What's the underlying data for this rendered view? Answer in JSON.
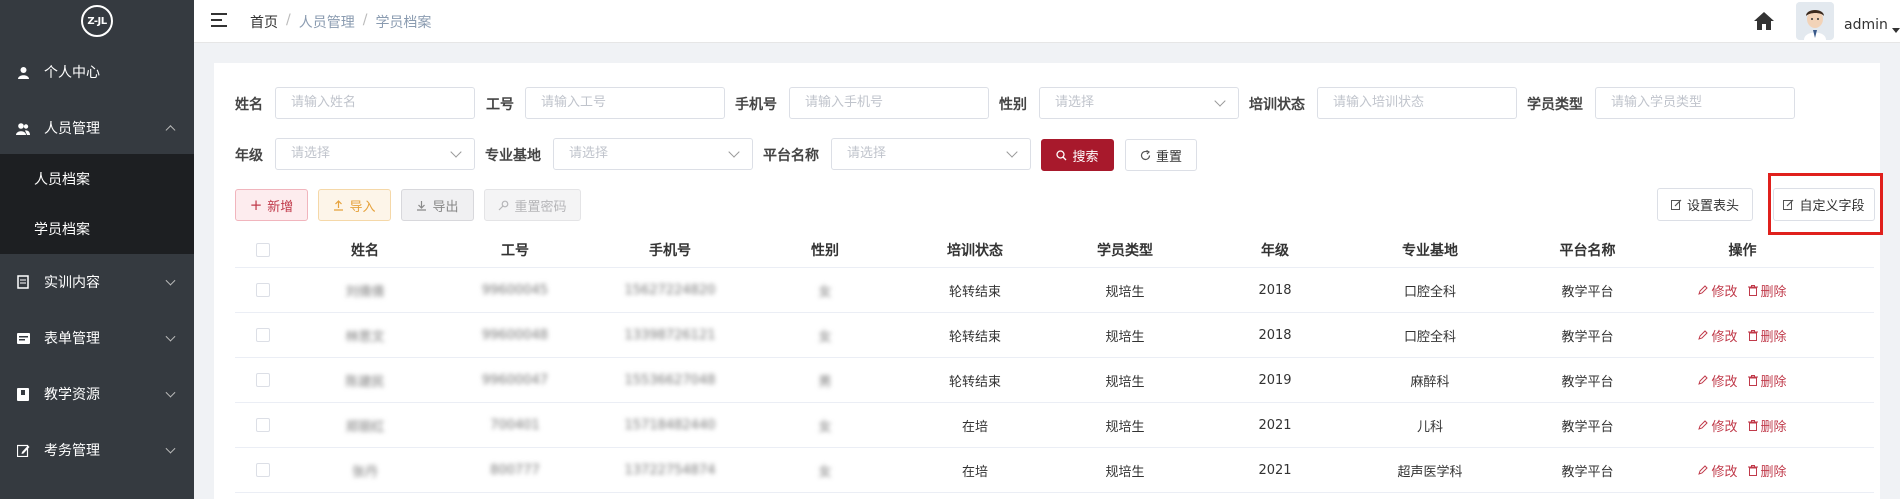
{
  "sidebar": {
    "logo_text": "Z-JL",
    "menu": [
      {
        "label": "个人中心",
        "icon": "user-icon"
      },
      {
        "label": "人员管理",
        "icon": "users-icon",
        "expanded": true,
        "children": [
          {
            "label": "人员档案"
          },
          {
            "label": "学员档案",
            "active": true
          }
        ]
      },
      {
        "label": "实训内容",
        "icon": "document-icon"
      },
      {
        "label": "表单管理",
        "icon": "form-icon"
      },
      {
        "label": "教学资源",
        "icon": "book-icon"
      },
      {
        "label": "考务管理",
        "icon": "edit-icon"
      }
    ]
  },
  "header": {
    "breadcrumb": [
      "首页",
      "人员管理",
      "学员档案"
    ],
    "user": "admin"
  },
  "filters": {
    "name": {
      "label": "姓名",
      "placeholder": "请输入姓名"
    },
    "work_no": {
      "label": "工号",
      "placeholder": "请输入工号"
    },
    "phone": {
      "label": "手机号",
      "placeholder": "请输入手机号"
    },
    "gender": {
      "label": "性别",
      "placeholder": "请选择"
    },
    "train_status": {
      "label": "培训状态",
      "placeholder": "请输入培训状态"
    },
    "student_type": {
      "label": "学员类型",
      "placeholder": "请输入学员类型"
    },
    "grade": {
      "label": "年级",
      "placeholder": "请选择"
    },
    "base": {
      "label": "专业基地",
      "placeholder": "请选择"
    },
    "platform": {
      "label": "平台名称",
      "placeholder": "请选择"
    },
    "search_label": "搜索",
    "reset_label": "重置"
  },
  "toolbar": {
    "add": "新增",
    "import": "导入",
    "export": "导出",
    "reset_pwd": "重置密码",
    "set_header": "设置表头",
    "custom_field": "自定义字段"
  },
  "table": {
    "columns": [
      "姓名",
      "工号",
      "手机号",
      "性别",
      "培训状态",
      "学员类型",
      "年级",
      "专业基地",
      "平台名称",
      "操作"
    ],
    "edit_label": "修改",
    "delete_label": "删除",
    "rows": [
      {
        "name": "刘倩倩",
        "no": "99600045",
        "phone": "15627224820",
        "gender": "女",
        "status": "轮转结束",
        "type": "规培生",
        "grade": "2018",
        "base": "口腔全科",
        "platform": "教学平台"
      },
      {
        "name": "林思文",
        "no": "99600048",
        "phone": "13398726121",
        "gender": "女",
        "status": "轮转结束",
        "type": "规培生",
        "grade": "2018",
        "base": "口腔全科",
        "platform": "教学平台"
      },
      {
        "name": "陈建民",
        "no": "99600047",
        "phone": "15536627048",
        "gender": "男",
        "status": "轮转结束",
        "type": "规培生",
        "grade": "2019",
        "base": "麻醉科",
        "platform": "教学平台"
      },
      {
        "name": "郑丽红",
        "no": "700401",
        "phone": "15718482440",
        "gender": "女",
        "status": "在培",
        "type": "规培生",
        "grade": "2021",
        "base": "儿科",
        "platform": "教学平台"
      },
      {
        "name": "张丹",
        "no": "800777",
        "phone": "13722754874",
        "gender": "女",
        "status": "在培",
        "type": "规培生",
        "grade": "2021",
        "base": "超声医学科",
        "platform": "教学平台"
      }
    ]
  }
}
